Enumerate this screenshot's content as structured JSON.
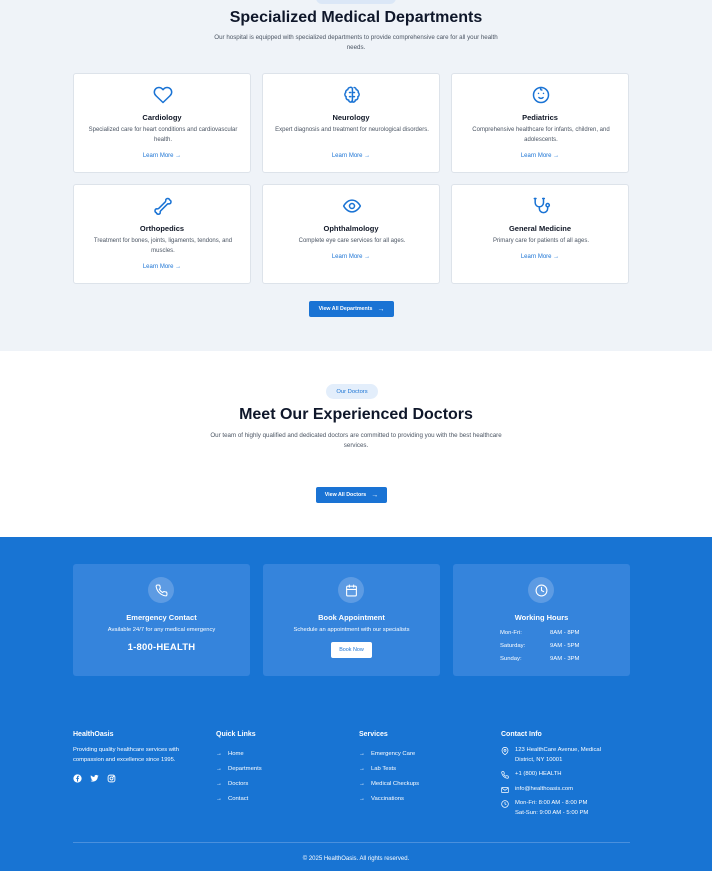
{
  "departments": {
    "title": "Specialized Medical Departments",
    "subtitle": "Our hospital is equipped with specialized departments to provide comprehensive care for all your health needs.",
    "items": [
      {
        "name": "Cardiology",
        "icon": "heart-icon",
        "description": "Specialized care for heart conditions and cardiovascular health.",
        "link": "Learn More →"
      },
      {
        "name": "Neurology",
        "icon": "brain-icon",
        "description": "Expert diagnosis and treatment for neurological disorders.",
        "link": "Learn More →"
      },
      {
        "name": "Pediatrics",
        "icon": "baby-face-icon",
        "description": "Comprehensive healthcare for infants, children, and adolescents.",
        "link": "Learn More →"
      },
      {
        "name": "Orthopedics",
        "icon": "bone-icon",
        "description": "Treatment for bones, joints, ligaments, tendons, and muscles.",
        "link": "Learn More →"
      },
      {
        "name": "Ophthalmology",
        "icon": "eye-icon",
        "description": "Complete eye care services for all ages.",
        "link": "Learn More →"
      },
      {
        "name": "General Medicine",
        "icon": "stethoscope-icon",
        "description": "Primary care for patients of all ages.",
        "link": "Learn More →"
      }
    ],
    "view_all": "View All Departments",
    "view_all_arrow": "→"
  },
  "doctors": {
    "pill": "Our Doctors",
    "title": "Meet Our Experienced Doctors",
    "subtitle": "Our team of highly qualified and dedicated doctors are committed to providing you with the best healthcare services.",
    "view_all": "View All Doctors",
    "view_all_arrow": "→"
  },
  "info_boxes": {
    "emergency": {
      "title": "Emergency Contact",
      "subtitle": "Available 24/7 for any medical emergency",
      "phone": "1-800-HEALTH",
      "icon": "phone-icon"
    },
    "appointment": {
      "title": "Book Appointment",
      "subtitle": "Schedule an appointment with our specialists",
      "button": "Book Now",
      "icon": "calendar-icon"
    },
    "hours": {
      "title": "Working Hours",
      "icon": "clock-icon",
      "rows": [
        {
          "day": "Mon-Fri:",
          "time": "8AM - 8PM"
        },
        {
          "day": "Saturday:",
          "time": "9AM - 5PM"
        },
        {
          "day": "Sunday:",
          "time": "9AM - 3PM"
        }
      ]
    }
  },
  "footer": {
    "brand": {
      "title": "HealthOasis",
      "text": "Providing quality healthcare services with compassion and excellence since 1995.",
      "social": [
        "facebook-icon",
        "twitter-icon",
        "instagram-icon"
      ]
    },
    "quick_links": {
      "title": "Quick Links",
      "items": [
        "Home",
        "Departments",
        "Doctors",
        "Contact"
      ]
    },
    "services": {
      "title": "Services",
      "items": [
        "Emergency Care",
        "Lab Tests",
        "Medical Checkups",
        "Vaccinations"
      ]
    },
    "contact": {
      "title": "Contact Info",
      "address": "123 HealthCare Avenue, Medical District, NY 10001",
      "phone": "+1 (800) HEALTH",
      "email": "info@healthoasis.com",
      "hours_weekday": "Mon-Fri: 8:00 AM - 8:00 PM",
      "hours_weekend": "Sat-Sun: 9:00 AM - 5:00 PM"
    },
    "copyright": "© 2025 HealthOasis. All rights reserved.",
    "link_arrow": "→"
  },
  "colors": {
    "primary": "#1a73d4",
    "footer_bg": "#1874d3",
    "section_bg": "#eff3f8"
  }
}
